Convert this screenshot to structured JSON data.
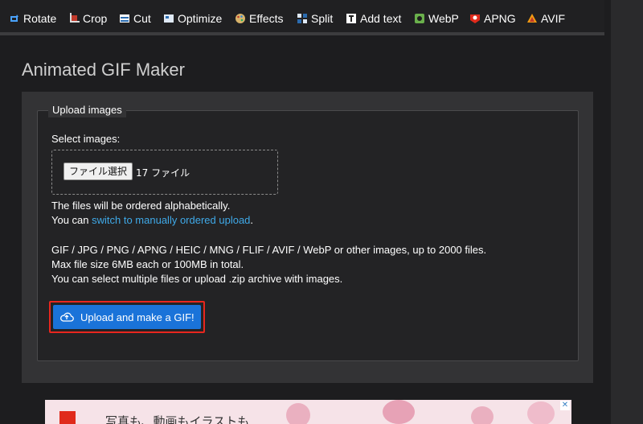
{
  "toolbar": {
    "items": [
      {
        "label": "Rotate",
        "icon": "rotate-icon"
      },
      {
        "label": "Crop",
        "icon": "crop-icon"
      },
      {
        "label": "Cut",
        "icon": "cut-icon"
      },
      {
        "label": "Optimize",
        "icon": "optimize-icon"
      },
      {
        "label": "Effects",
        "icon": "effects-icon"
      },
      {
        "label": "Split",
        "icon": "split-icon"
      },
      {
        "label": "Add text",
        "icon": "add-text-icon"
      },
      {
        "label": "WebP",
        "icon": "webp-icon"
      },
      {
        "label": "APNG",
        "icon": "apng-icon"
      },
      {
        "label": "AVIF",
        "icon": "avif-icon"
      }
    ]
  },
  "page": {
    "title": "Animated GIF Maker"
  },
  "upload": {
    "legend": "Upload images",
    "select_label": "Select images:",
    "file_button": "ファイル選択",
    "file_status": "17 ファイル",
    "ordered_note": "The files will be ordered alphabetically.",
    "switch_prefix": "You can ",
    "switch_link": "switch to manually ordered upload",
    "switch_suffix": ".",
    "formats_note": "GIF / JPG / PNG / APNG / HEIC / MNG / FLIF / AVIF / WebP or other images, up to 2000 files.",
    "size_note": "Max file size 6MB each or 100MB in total.",
    "zip_note": "You can select multiple files or upload .zip archive with images.",
    "submit_label": "Upload and make a GIF!",
    "submit_icon": "cloud-upload-icon"
  },
  "ad": {
    "text": "写真も、動画もイラストも",
    "close_label": "✕"
  },
  "colors": {
    "background": "#1d1d1f",
    "panel": "#333335",
    "link": "#3fa9e8",
    "button": "#1a73d9",
    "highlight": "#e8261e"
  }
}
